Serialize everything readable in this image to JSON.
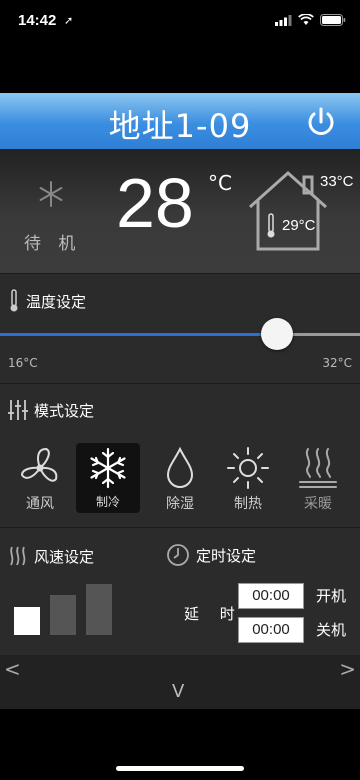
{
  "status_bar": {
    "time": "14:42"
  },
  "header": {
    "title": "地址1-09"
  },
  "current": {
    "mode_status": "待 机",
    "set_temp": "28",
    "unit": "°C",
    "outdoor_temp": "33°C",
    "indoor_temp": "29°C"
  },
  "temperature": {
    "section_label": "温度设定",
    "min_label": "16°C",
    "max_label": "32°C",
    "value_fraction": 0.77
  },
  "modes": {
    "section_label": "模式设定",
    "items": [
      {
        "label": "通风",
        "icon": "fan-icon"
      },
      {
        "label": "制冷",
        "icon": "snowflake-icon",
        "active": true
      },
      {
        "label": "除湿",
        "icon": "droplet-icon"
      },
      {
        "label": "制热",
        "icon": "sun-icon"
      },
      {
        "label": "采暖",
        "icon": "heating-icon"
      }
    ]
  },
  "fan_speed": {
    "section_label": "风速设定",
    "selected_level": 1,
    "levels": 3
  },
  "timer": {
    "section_label": "定时设定",
    "delay_label": "延 时",
    "on_time": "00:00",
    "on_label": "开机",
    "off_time": "00:00",
    "off_label": "关机"
  },
  "nav": {
    "prev": "<",
    "next": ">",
    "down": "V"
  }
}
